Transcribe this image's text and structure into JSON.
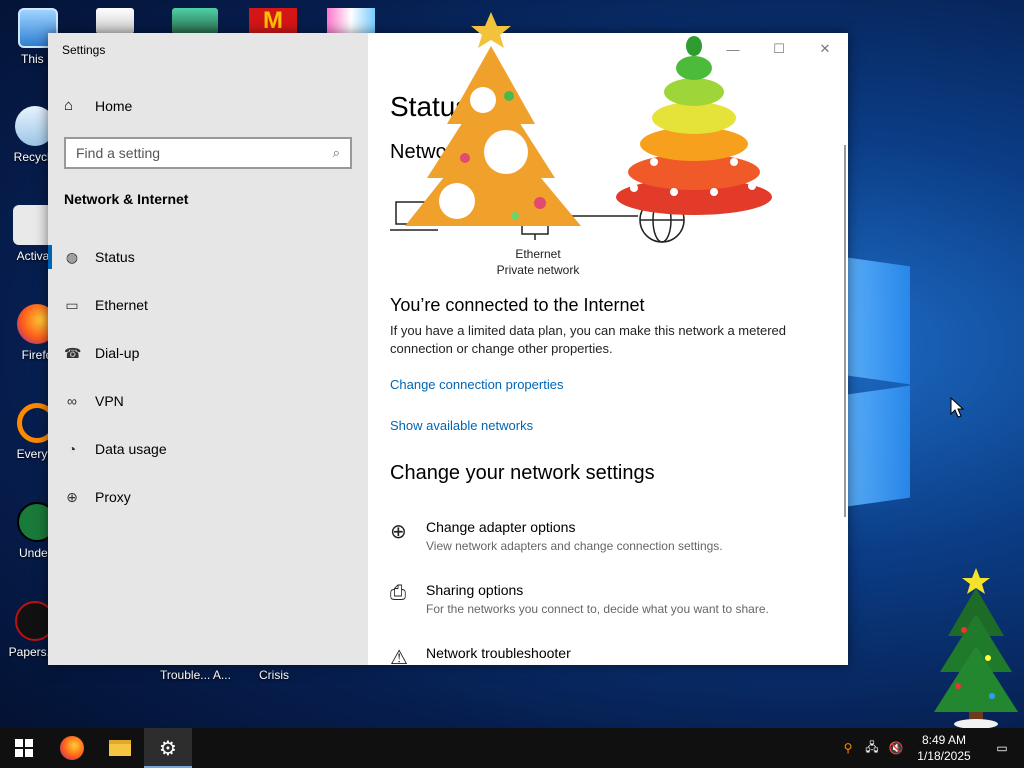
{
  "desktop": {
    "icons": [
      {
        "label": "This P",
        "icon": "this-pc-icon"
      },
      {
        "label": "Recycle",
        "icon": "recycle-bin-icon"
      },
      {
        "label": "Activa",
        "icon": "activation-icon"
      },
      {
        "label": "Firefo",
        "icon": "firefox-icon"
      },
      {
        "label": "Everyth",
        "icon": "everything-search-icon"
      },
      {
        "label": "Undert",
        "icon": "undertale-icon"
      },
      {
        "label": "Papers, P",
        "icon": "papers-please-icon"
      }
    ],
    "bottom_labels": [
      "Trouble... A...",
      "Crisis"
    ]
  },
  "window": {
    "title": "Settings",
    "controls": {
      "minimize": "—",
      "maximize": "☐",
      "close": "✕"
    }
  },
  "sidebar": {
    "home": "Home",
    "search_placeholder": "Find a setting",
    "section": "Network & Internet",
    "items": [
      {
        "label": "Status",
        "icon": "globe-icon",
        "active": true
      },
      {
        "label": "Ethernet",
        "icon": "ethernet-icon"
      },
      {
        "label": "Dial-up",
        "icon": "dialup-icon"
      },
      {
        "label": "VPN",
        "icon": "vpn-icon"
      },
      {
        "label": "Data usage",
        "icon": "data-usage-icon"
      },
      {
        "label": "Proxy",
        "icon": "proxy-globe-icon"
      }
    ]
  },
  "main": {
    "title": "Status",
    "subtitle": "Network status",
    "diagram": {
      "adapter": "Ethernet",
      "network": "Private network"
    },
    "connected_title": "You’re connected to the Internet",
    "connected_desc": "If you have a limited data plan, you can make this network a metered connection or change other properties.",
    "link_change_props": "Change connection properties",
    "link_show_networks": "Show available networks",
    "change_head": "Change your network settings",
    "options": [
      {
        "title": "Change adapter options",
        "desc": "View network adapters and change connection settings.",
        "icon": "adapter-icon"
      },
      {
        "title": "Sharing options",
        "desc": "For the networks you connect to, decide what you want to share.",
        "icon": "sharing-icon"
      },
      {
        "title": "Network troubleshooter",
        "desc": "",
        "icon": "warning-icon"
      }
    ]
  },
  "taskbar": {
    "time": "8:49 AM",
    "date": "1/18/2025"
  }
}
